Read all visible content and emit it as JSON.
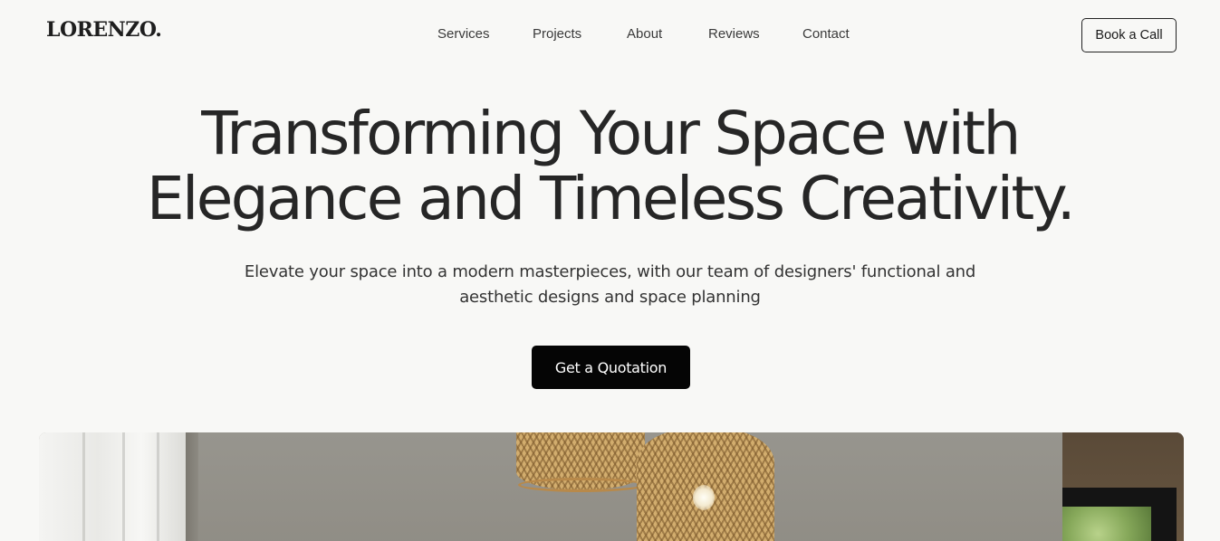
{
  "brand": {
    "logo": "LORENZO."
  },
  "nav": {
    "items": [
      {
        "label": "Services"
      },
      {
        "label": "Projects"
      },
      {
        "label": "About"
      },
      {
        "label": "Reviews"
      },
      {
        "label": "Contact"
      }
    ]
  },
  "header": {
    "cta_label": "Book a Call"
  },
  "hero": {
    "title_line1": "Transforming Your Space with",
    "title_line2": "Elegance and Timeless Creativity.",
    "subtitle_line1": "Elevate your space into a modern masterpieces, with our team of designers' functional and",
    "subtitle_line2": "aesthetic designs and space planning",
    "cta_label": "Get a Quotation"
  },
  "colors": {
    "background": "#f8f8f6",
    "primary_button": "#050505",
    "text": "#262626"
  }
}
